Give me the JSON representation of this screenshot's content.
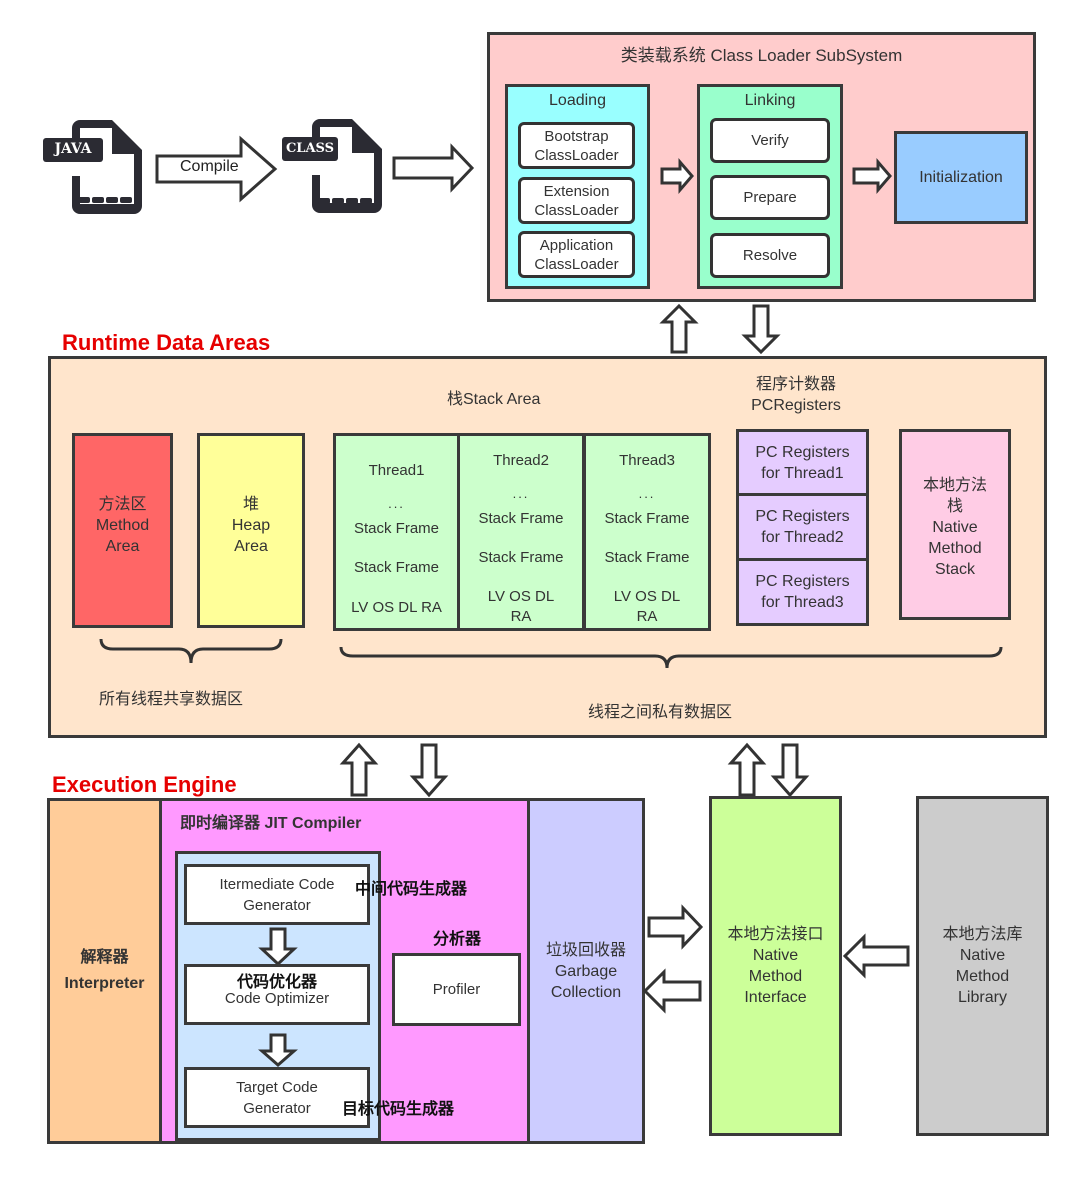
{
  "source": {
    "java_label": "JAVA",
    "class_label": "CLASS",
    "compile_label": "Compile"
  },
  "class_loader": {
    "title": "类装载系统 Class Loader SubSystem",
    "loading": {
      "title": "Loading",
      "items": [
        "Bootstrap\nClassLoader",
        "Extension\nClassLoader",
        "Application\nClassLoader"
      ]
    },
    "linking": {
      "title": "Linking",
      "items": [
        "Verify",
        "Prepare",
        "Resolve"
      ]
    },
    "initialization": "Initialization"
  },
  "runtime": {
    "section_title": "Runtime Data Areas",
    "method_area": "方法区\nMethod\nArea",
    "heap_area": "堆\nHeap\nArea",
    "stack_title": "栈Stack Area",
    "threads": [
      {
        "name": "Thread1",
        "dots": "...",
        "frames": [
          "Stack Frame",
          "Stack Frame"
        ],
        "locals": "LV OS DL RA"
      },
      {
        "name": "Thread2",
        "dots": "...",
        "frames": [
          "Stack Frame",
          "Stack Frame"
        ],
        "locals": "LV OS DL\nRA"
      },
      {
        "name": "Thread3",
        "dots": "...",
        "frames": [
          "Stack Frame",
          "Stack Frame"
        ],
        "locals": "LV OS DL\nRA"
      }
    ],
    "pc_title": "程序计数器\nPCRegisters",
    "pc_registers": [
      "PC Registers\nfor Thread1",
      "PC Registers\nfor Thread2",
      "PC Registers\nfor Thread3"
    ],
    "native_stack": "本地方法\n栈\nNative\nMethod\nStack",
    "shared_label": "所有线程共享数据区",
    "private_label": "线程之间私有数据区"
  },
  "execution": {
    "section_title": "Execution Engine",
    "interpreter": "解释器\nInterpreter",
    "jit_title": "即时编译器 JIT Compiler",
    "intermediate": "Itermediate Code\nGenerator",
    "intermediate_cn": "中间代码生成器",
    "optimizer_cn": "代码优化器",
    "optimizer": "Code Optimizer",
    "target": "Target Code\nGenerator",
    "target_cn": "目标代码生成器",
    "profiler_cn": "分析器",
    "profiler": "Profiler",
    "gc": "垃圾回收器\nGarbage\nCollection",
    "native_interface": "本地方法接口\nNative\nMethod\nInterface",
    "native_library": "本地方法库\nNative\nMethod\nLibrary"
  },
  "colors": {
    "class_loader_bg": "#ffcccc",
    "loading_bg": "#99ffff",
    "linking_bg": "#99ffcc",
    "initialization_bg": "#99ccff",
    "runtime_bg": "#ffe5cc",
    "method_area_bg": "#ff6666",
    "heap_bg": "#ffff99",
    "thread_bg": "#ccffcc",
    "pc_bg": "#e5ccff",
    "native_stack_bg": "#ffcce5",
    "interpreter_bg": "#ffcc99",
    "jit_bg": "#ff99ff",
    "jit_inner_bg": "#cce5ff",
    "gc_bg": "#ccccff",
    "native_interface_bg": "#ccff99",
    "native_library_bg": "#cccccc",
    "section_title": "#e60000"
  }
}
